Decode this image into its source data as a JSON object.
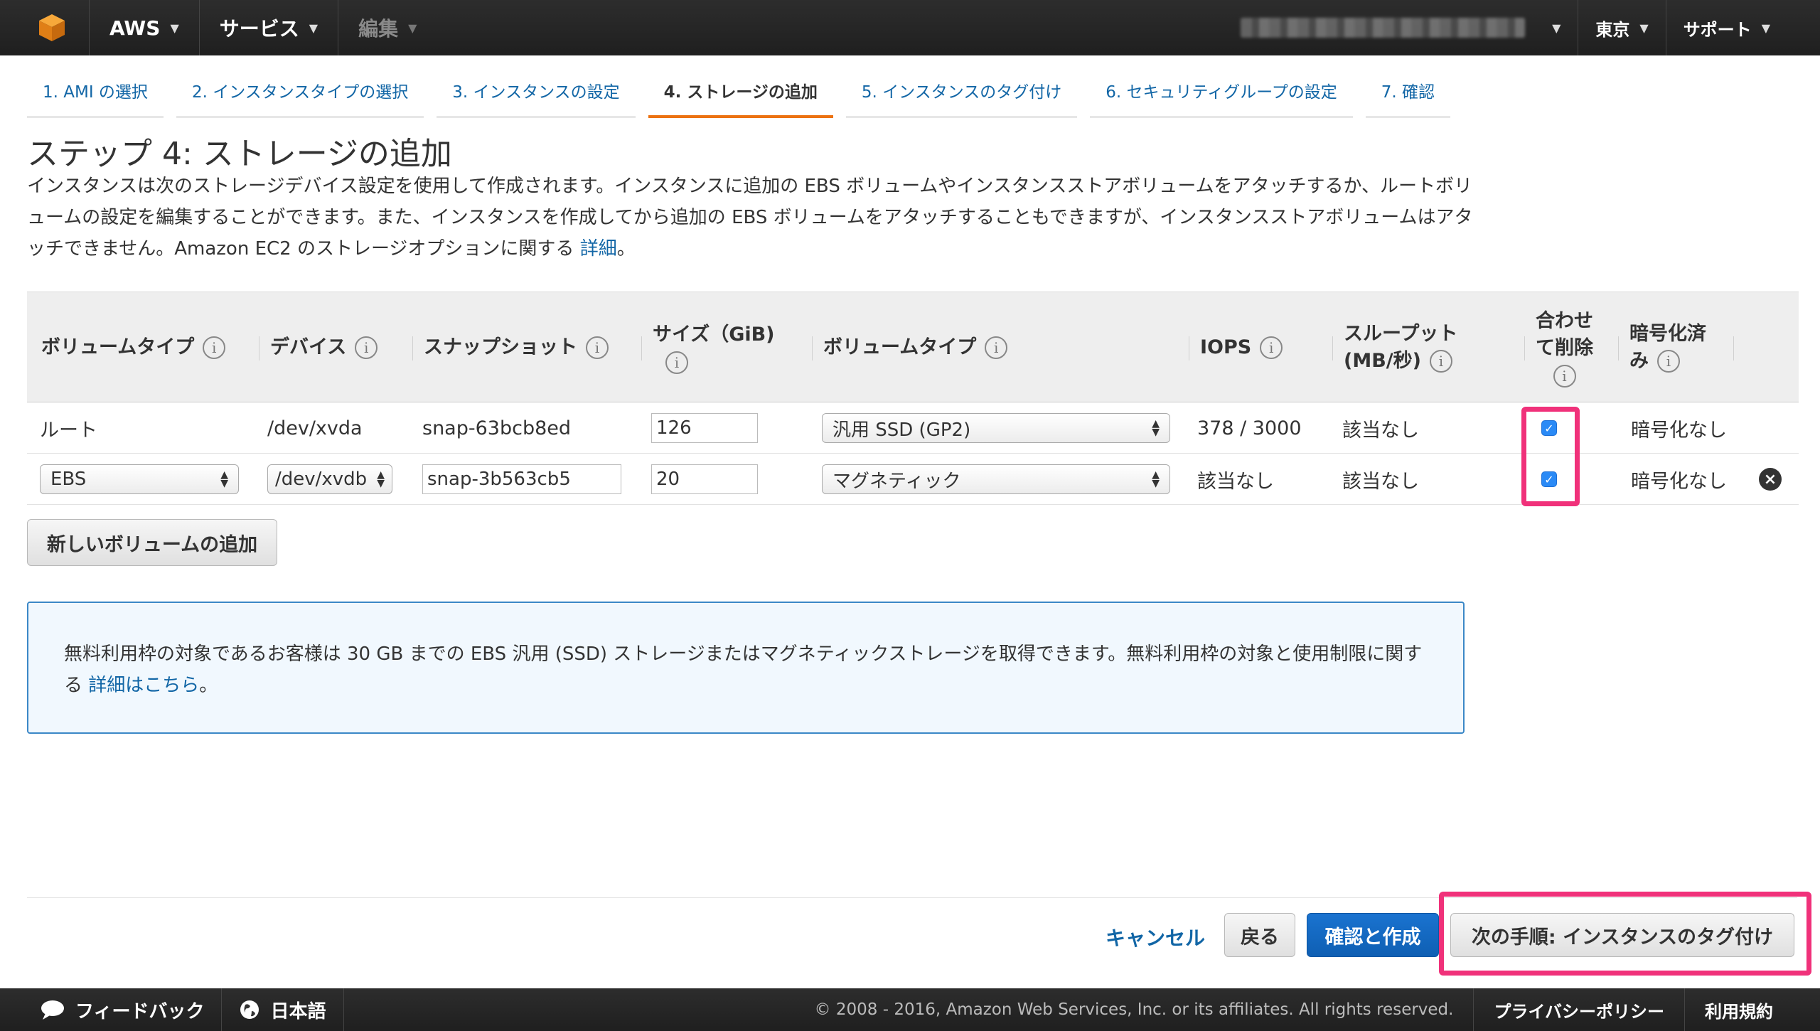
{
  "topbar": {
    "brand": "AWS",
    "services": "サービス",
    "edit": "編集",
    "region": "東京",
    "support": "サポート"
  },
  "steps": [
    {
      "label": "1. AMI の選択"
    },
    {
      "label": "2. インスタンスタイプの選択"
    },
    {
      "label": "3. インスタンスの設定"
    },
    {
      "label": "4. ストレージの追加"
    },
    {
      "label": "5. インスタンスのタグ付け"
    },
    {
      "label": "6. セキュリティグループの設定"
    },
    {
      "label": "7. 確認"
    }
  ],
  "page": {
    "title": "ステップ 4: ストレージの追加",
    "description": "インスタンスは次のストレージデバイス設定を使用して作成されます。インスタンスに追加の EBS ボリュームやインスタンスストアボリュームをアタッチするか、ルートボリュームの設定を編集することができます。また、インスタンスを作成してから追加の EBS ボリュームをアタッチすることもできますが、インスタンスストアボリュームはアタッチできません。Amazon EC2 のストレージオプションに関する ",
    "description_link": "詳細",
    "description_end": "。"
  },
  "table": {
    "headers": {
      "volume_type": "ボリュームタイプ",
      "device": "デバイス",
      "snapshot": "スナップショット",
      "size": "サイズ（GiB)",
      "volume_type2": "ボリュームタイプ",
      "iops": "IOPS",
      "throughput_1": "スループット",
      "throughput_2": "(MB/秒)",
      "delete_1": "合わせ",
      "delete_2": "て削除",
      "encrypted_1": "暗号化済",
      "encrypted_2": "み"
    },
    "rows": [
      {
        "volume_type": "ルート",
        "device": "/dev/xvda",
        "snapshot": "snap-63bcb8ed",
        "size": "126",
        "vol_type": "汎用 SSD (GP2)",
        "iops": "378 / 3000",
        "throughput": "該当なし",
        "encrypted": "暗号化なし"
      },
      {
        "volume_type": "EBS",
        "device": "/dev/xvdb",
        "snapshot": "snap-3b563cb5",
        "size": "20",
        "vol_type": "マグネティック",
        "iops": "該当なし",
        "throughput": "該当なし",
        "encrypted": "暗号化なし"
      }
    ]
  },
  "add_volume_button": "新しいボリュームの追加",
  "info_box": {
    "text": "無料利用枠の対象であるお客様は 30 GB までの EBS 汎用 (SSD) ストレージまたはマグネティックストレージを取得できます。無料利用枠の対象と使用制限に関する ",
    "link": "詳細はこちら",
    "end": "。"
  },
  "actions": {
    "cancel": "キャンセル",
    "back": "戻る",
    "review": "確認と作成",
    "next": "次の手順: インスタンスのタグ付け"
  },
  "footer": {
    "feedback": "フィードバック",
    "language": "日本語",
    "copyright": "© 2008 - 2016, Amazon Web Services, Inc. or its affiliates. All rights reserved.",
    "privacy": "プライバシーポリシー",
    "terms": "利用規約"
  },
  "colors": {
    "accent": "#ec7211",
    "link": "#1266a6",
    "primary_button": "#1a73d0",
    "highlight": "#f0317a"
  }
}
